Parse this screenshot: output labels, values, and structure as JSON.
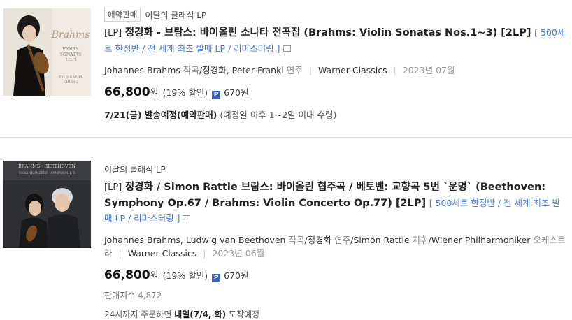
{
  "items": [
    {
      "badge": "예약판매",
      "category": "이달의 클래식 LP",
      "format": "[LP]",
      "title": "정경화 - 브람스: 바이올린 소나타 전곡집 (Brahms: Violin Sonatas Nos.1~3) [2LP]",
      "subtitle": "[ 500세트 한정반 / 전 세계 최초 발매 LP / 리마스터링 ]",
      "composer": "Johannes Brahms",
      "composer_role": "작곡",
      "performer": "/정경화, Peter Frankl",
      "performer_role": "연주",
      "label": "Warner Classics",
      "date": "2023년 07월",
      "price": "66,800",
      "currency": "원",
      "discount": "(19% 할인)",
      "points_icon": "P",
      "points": "670원",
      "ship_date": "7/21(금) 발송예정(예약판매)",
      "ship_note": " (예정일 이후 1~2일 이내 수령)",
      "cover_text": "Brahms · Violin Sonatas"
    },
    {
      "category": "이달의 클래식 LP",
      "format": "[LP]",
      "title": "정경화 / Simon Rattle 브람스: 바이올린 협주곡 / 베토벤: 교향곡 5번 `운명` (Beethoven: Symphony Op.67 / Brahms: Violin Concerto Op.77) [2LP]",
      "subtitle": "[ 500세트 한정반 / 전 세계 최초 발매 LP / 리마스터링 ]",
      "composer": "Johannes Brahms, Ludwig van Beethoven",
      "composer_role": "작곡",
      "performer": "/정경화",
      "performer_role": "연주",
      "conductor": "/Simon Rattle",
      "conductor_role": "지휘",
      "orchestra": "/Wiener Philharmoniker",
      "orchestra_role": "오케스트라",
      "label": "Warner Classics",
      "date": "2023년 06월",
      "price": "66,800",
      "currency": "원",
      "discount": "(19% 할인)",
      "points_icon": "P",
      "points": "670원",
      "sales_label": "판매지수",
      "sales_value": "4,872",
      "order_prefix": "24시까지 주문하면 ",
      "order_date": "내일(7/4, 화)",
      "order_suffix": " 도착예정",
      "cover_text": "BRAHMS VIOLINKONZERT · BEETHOVEN SYMPHONIE 5"
    }
  ],
  "colors": {
    "link": "#4a7bd0",
    "points_badge": "#3b64b8",
    "divider": "#e6e6e6"
  }
}
